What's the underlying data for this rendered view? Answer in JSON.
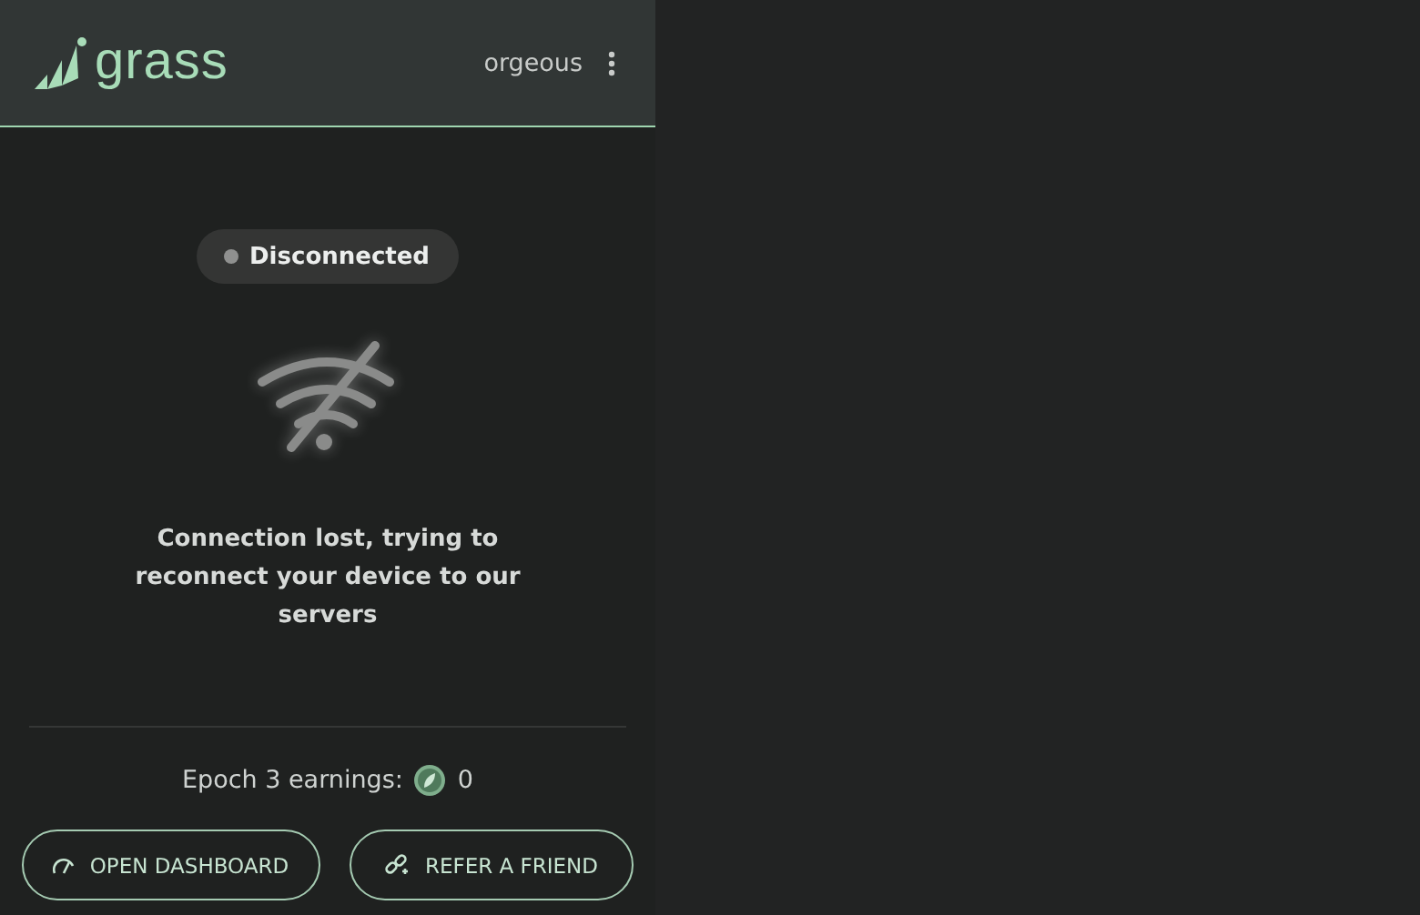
{
  "header": {
    "logo": "grass",
    "username": "orgeous"
  },
  "status": {
    "label": "Disconnected",
    "connected": false
  },
  "message": "Connection lost, trying to reconnect your device to our servers",
  "earnings": {
    "label": "Epoch 3 earnings:",
    "value": "0"
  },
  "buttons": [
    {
      "kind": "dashboard",
      "label": "OPEN DASHBOARD"
    },
    {
      "kind": "refer",
      "label": "REFER A FRIEND"
    }
  ]
}
